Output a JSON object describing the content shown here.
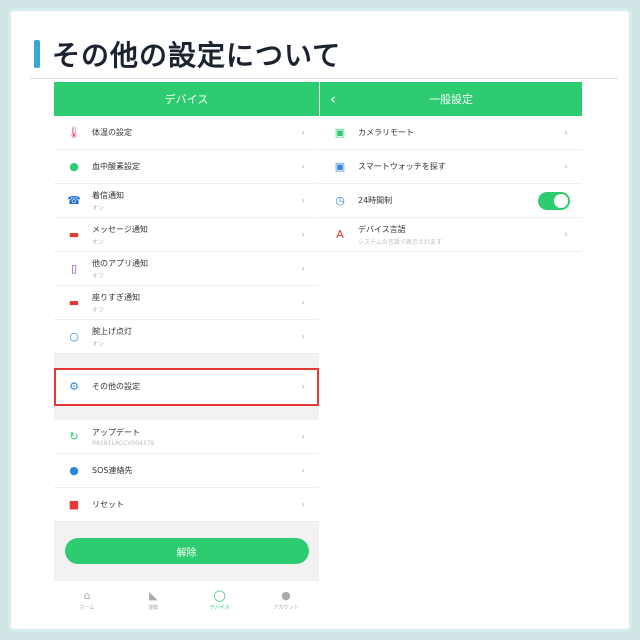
{
  "page_title": "その他の設定について",
  "left": {
    "nav_title": "デバイス",
    "group1": [
      {
        "label": "体温の設定",
        "sub": "",
        "icon": "thermometer-icon",
        "color": "#e94b8a"
      },
      {
        "label": "血中酸素設定",
        "sub": "",
        "icon": "drop-icon",
        "color": "#2ecc71"
      },
      {
        "label": "着信通知",
        "sub": "オン",
        "icon": "phone-icon",
        "color": "#1f6fd1"
      },
      {
        "label": "メッセージ通知",
        "sub": "オン",
        "icon": "message-icon",
        "color": "#e53935"
      },
      {
        "label": "他のアプリ通知",
        "sub": "オフ",
        "icon": "app-icon",
        "color": "#8e44ad"
      },
      {
        "label": "座りすぎ通知",
        "sub": "オフ",
        "icon": "sofa-icon",
        "color": "#e53935"
      },
      {
        "label": "腕上げ点灯",
        "sub": "オン",
        "icon": "watch-icon",
        "color": "#2e86de"
      }
    ],
    "other_settings": {
      "label": "その他の設定",
      "icon": "gear-icon",
      "color": "#2e86de"
    },
    "group2": [
      {
        "label": "アップデート",
        "sub": "R8281LACCV004379",
        "icon": "refresh-icon",
        "color": "#2ecc71"
      },
      {
        "label": "SOS連絡先",
        "sub": "",
        "icon": "sos-icon",
        "color": "#2e86de"
      },
      {
        "label": "リセット",
        "sub": "",
        "icon": "trash-icon",
        "color": "#e53935"
      }
    ],
    "unpair_label": "解除",
    "tabs": [
      {
        "label": "ホーム",
        "icon": "home-icon",
        "active": false
      },
      {
        "label": "運動",
        "icon": "shoe-icon",
        "active": false
      },
      {
        "label": "デバイス",
        "icon": "device-icon",
        "active": true
      },
      {
        "label": "アカウント",
        "icon": "person-icon",
        "active": false
      }
    ]
  },
  "right": {
    "nav_title": "一般設定",
    "back_glyph": "‹",
    "items": [
      {
        "label": "カメラリモート",
        "sub": "",
        "icon": "camera-icon",
        "color": "#2ecc71",
        "type": "chevron"
      },
      {
        "label": "スマートウォッチを探す",
        "sub": "",
        "icon": "search-icon",
        "color": "#2e86de",
        "type": "chevron"
      },
      {
        "label": "24時間制",
        "sub": "",
        "icon": "clock-icon",
        "color": "#2e86de",
        "type": "toggle",
        "toggle_on": true
      },
      {
        "label": "デバイス言語",
        "sub": "システムの言語で表示されます",
        "icon": "language-icon",
        "color": "#e53935",
        "type": "chevron"
      }
    ]
  },
  "chevron": "›"
}
